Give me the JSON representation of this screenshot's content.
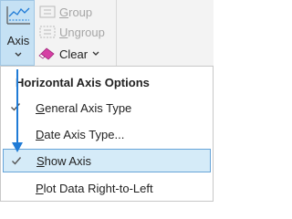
{
  "ribbon": {
    "axis": {
      "label": "Axis",
      "icon": "axis-chart-icon"
    },
    "group": {
      "label": "Group",
      "underline": "G",
      "rest": "roup",
      "enabled": false,
      "icon": "group-icon"
    },
    "ungroup": {
      "label": "Ungroup",
      "underline": "U",
      "rest": "ngroup",
      "enabled": false,
      "icon": "ungroup-icon"
    },
    "clear": {
      "label": "Clear",
      "icon": "eraser-icon"
    }
  },
  "menu": {
    "header": "Horizontal Axis Options",
    "items": [
      {
        "label": "General Axis Type",
        "underline": "G",
        "rest": "eneral Axis Type",
        "checked": true,
        "selected": false
      },
      {
        "label": "Date Axis Type...",
        "underline": "D",
        "rest": "ate Axis Type...",
        "checked": false,
        "selected": false
      },
      {
        "label": "Show Axis",
        "underline": "S",
        "rest": "how Axis",
        "checked": true,
        "selected": true
      },
      {
        "label": "Plot Data Right-to-Left",
        "underline": "P",
        "rest": "lot Data Right-to-Left",
        "checked": false,
        "selected": false
      }
    ]
  },
  "colors": {
    "accent_blue": "#1f7bd6",
    "selected_bg": "#d5ebf8",
    "pressed_button_bg": "#c5e1f4",
    "disabled_text": "#a6a6a6"
  }
}
